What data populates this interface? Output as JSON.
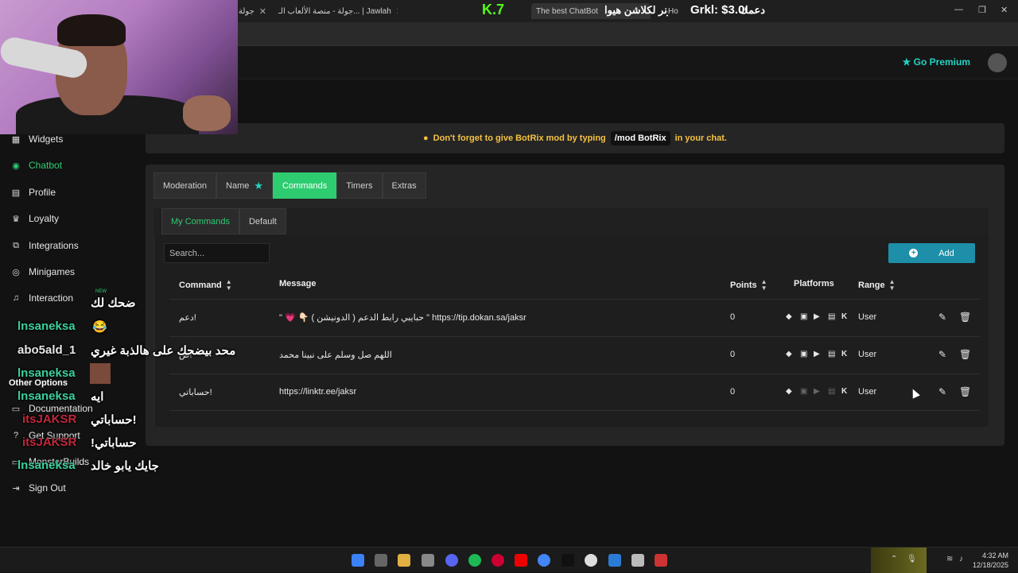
{
  "browser": {
    "tabs": [
      {
        "label": "جولة"
      },
      {
        "label": "جولة - منصة الألعاب الـ... | Jawlah"
      },
      {
        "label": "The best ChatBot"
      },
      {
        "label": "Ho"
      }
    ],
    "overlay_kick": "K.7",
    "overlay_banner": "الاونر لكلاشن هيوا",
    "overlay_donation": "Grkl: $3.00",
    "overlay_donation_label": "دعمك"
  },
  "appbar": {
    "premium_label": "Go Premium"
  },
  "sidebar": {
    "items": [
      {
        "label": "Widgets",
        "icon": "widgets-icon"
      },
      {
        "label": "Chatbot",
        "icon": "android-icon",
        "active": true
      },
      {
        "label": "Profile",
        "icon": "profile-card-icon"
      },
      {
        "label": "Loyalty",
        "icon": "trophy-icon"
      },
      {
        "label": "Integrations",
        "icon": "integrations-icon"
      },
      {
        "label": "Minigames",
        "icon": "gamepad-icon"
      },
      {
        "label": "Interaction",
        "icon": "music-icon",
        "badge": "NEW"
      }
    ],
    "other_options_title": "Other Options",
    "other_items": [
      {
        "label": "Documentation"
      },
      {
        "label": "Get Support"
      },
      {
        "label": "MonsterBuilds"
      },
      {
        "label": "Sign Out"
      }
    ]
  },
  "chat_overlay": [
    {
      "user": "",
      "message": "ضحك لك"
    },
    {
      "user": "lnsaneksa",
      "message": "😂"
    },
    {
      "user": "abo5ald_1",
      "message": "محد بيضحك على هالذبة غيري"
    },
    {
      "user": "lnsaneksa",
      "message": ""
    },
    {
      "user": "lnsaneksa",
      "message": "ايه"
    },
    {
      "user": "itsJAKSR",
      "message": "حساباتي!"
    },
    {
      "user": "itsJAKSR",
      "message": "!حساباتي"
    },
    {
      "user": "lnsaneksa",
      "message": "جايك يابو خالد"
    }
  ],
  "notice": {
    "prefix": "Don't forget to give BotRix mod by typing",
    "code": "/mod BotRix",
    "suffix": "in your chat."
  },
  "tabs": {
    "main": [
      "Moderation",
      "Name",
      "Commands",
      "Timers",
      "Extras"
    ],
    "sub": [
      "My Commands",
      "Default"
    ]
  },
  "commands": {
    "search_placeholder": "Search...",
    "add_label": "Add",
    "headers": {
      "command": "Command",
      "message": "Message",
      "points": "Points",
      "platforms": "Platforms",
      "range": "Range"
    },
    "rows": [
      {
        "command": "دعم!",
        "message": "\" 💗 👇🏻 حبايبي رابط الدعم ( الدونيشن ) \" https://tip.dokan.sa/jaksr",
        "points": "0",
        "range": "User",
        "platforms_enabled": [
          true,
          true,
          true,
          true,
          true
        ]
      },
      {
        "command": "ص!",
        "message": "اللهم صل وسلم على نبينا محمد",
        "points": "0",
        "range": "User",
        "platforms_enabled": [
          true,
          true,
          true,
          true,
          true
        ]
      },
      {
        "command": "حساباتي!",
        "message": "https://linktr.ee/jaksr",
        "points": "0",
        "range": "User",
        "platforms_enabled": [
          true,
          false,
          false,
          false,
          true
        ]
      }
    ]
  },
  "taskbar": {
    "time": "4:32 AM",
    "date": "12/18/2025"
  },
  "colors": {
    "accent_green": "#2ecc71",
    "accent_teal": "#22d3c5",
    "add_button": "#1e8fa8",
    "warning": "#f5c242"
  }
}
